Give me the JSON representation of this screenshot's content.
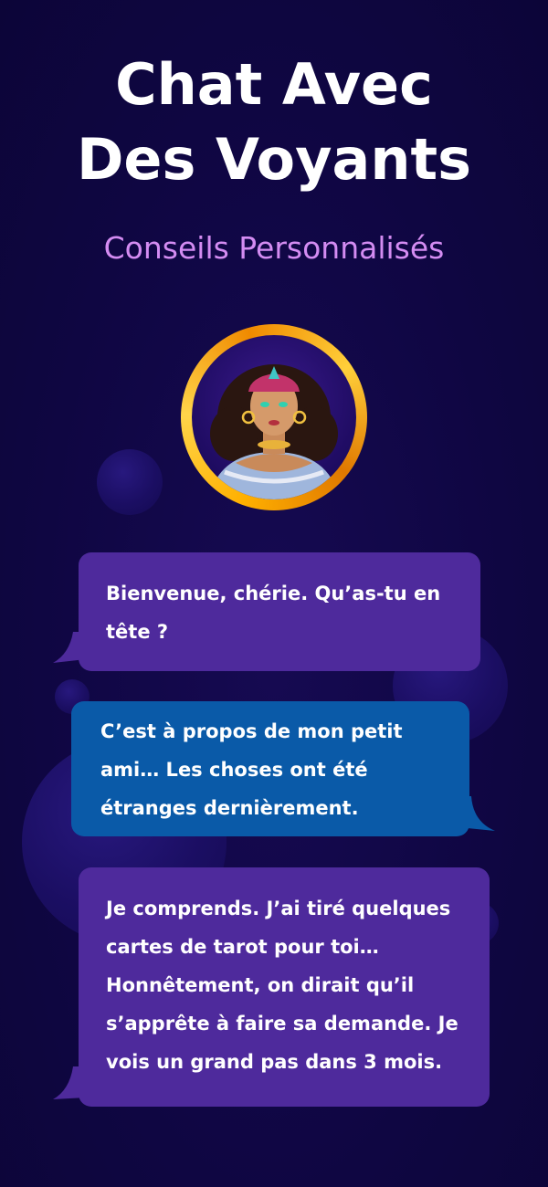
{
  "header": {
    "title_line1": "Chat Avec",
    "title_line2": "Des Voyants",
    "subtitle": "Conseils Personnalisés"
  },
  "avatar": {
    "icon": "psychic-avatar-icon"
  },
  "chat": {
    "messages": [
      {
        "sender": "psychic",
        "lines": [
          "Bienvenue, chérie. Qu’as-tu en",
          "tête ?"
        ]
      },
      {
        "sender": "user",
        "lines": [
          "C’est à propos de mon petit",
          "ami… Les choses ont été",
          "étranges dernièrement."
        ]
      },
      {
        "sender": "psychic",
        "lines": [
          "Je comprends. J’ai tiré quelques",
          "cartes de tarot pour toi…",
          "Honnêtement, on dirait qu’il",
          "s’apprête à faire sa demande. Je",
          "vois un grand pas dans 3 mois."
        ]
      }
    ]
  },
  "colors": {
    "background": "#0f0642",
    "subtitle": "#d48cf2",
    "psychic_bubble": "#4e2a9c",
    "user_bubble": "#0a5aa8",
    "avatar_ring": "#ffb000"
  }
}
